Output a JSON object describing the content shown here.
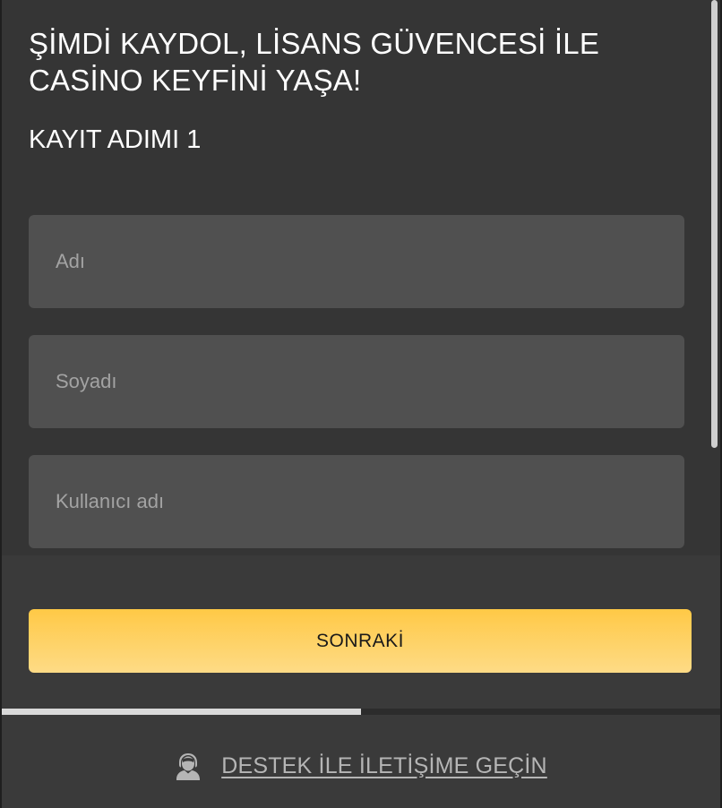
{
  "modal": {
    "title": "ŞİMDİ KAYDOL, LİSANS GÜVENCESİ İLE CASİNO KEYFİNİ YAŞA!",
    "step_label": "KAYIT ADIMI 1"
  },
  "form": {
    "first_name": {
      "value": "",
      "placeholder": "Adı"
    },
    "last_name": {
      "value": "",
      "placeholder": "Soyadı"
    },
    "username": {
      "value": "",
      "placeholder": "Kullanıcı adı"
    }
  },
  "footer": {
    "next_label": "SONRAKİ",
    "progress_fraction": 0.5,
    "support_label": "DESTEK İLE İLETİŞİME GEÇİN",
    "support_icon": "support-agent-icon"
  },
  "colors": {
    "background": "#353535",
    "input_bg": "#505050",
    "accent_top": "#ffc946",
    "accent_bottom": "#fedb86"
  }
}
